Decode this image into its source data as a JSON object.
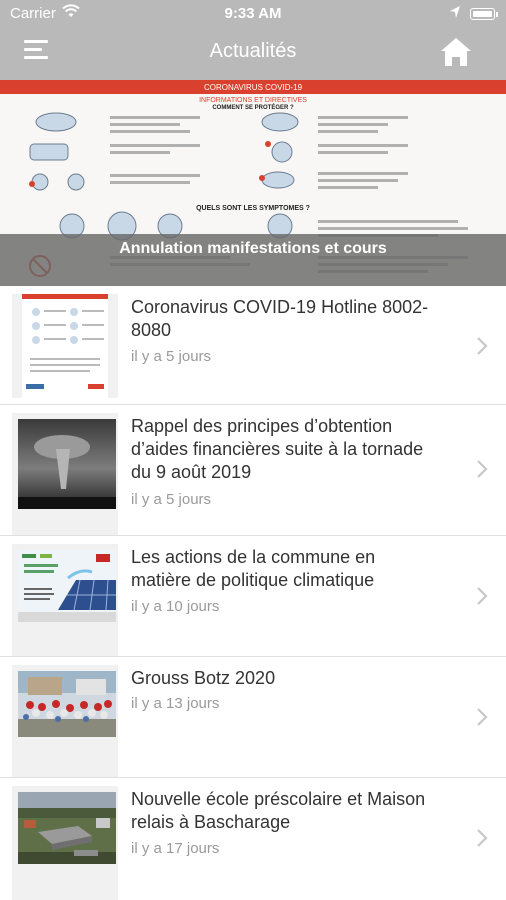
{
  "status_bar": {
    "carrier": "Carrier",
    "time": "9:33 AM"
  },
  "nav": {
    "title": "Actualités",
    "menu_icon": "hamburger-icon",
    "home_icon": "home-icon"
  },
  "hero": {
    "caption": "Annulation manifestations et cours",
    "poster_heading_1": "CORONAVIRUS COVID-19",
    "poster_heading_2": "INFORMATIONS ET DIRECTIVES",
    "poster_section_1": "COMMENT SE PROTÉGER ?",
    "poster_section_2": "QUELS SONT LES SYMPTOMES ?"
  },
  "news": [
    {
      "title": "Coronavirus COVID-19 Hotline 8002-8080",
      "date": "il y a 5 jours"
    },
    {
      "title": "Rappel des principes d’obtention d’aides financières suite à la tornade du 9 août 2019",
      "date": "il y a 5 jours"
    },
    {
      "title": "Les actions de la commune en matière de politique climatique",
      "date": "il y a 10 jours"
    },
    {
      "title": "Grouss Botz 2020",
      "date": "il y a 13 jours"
    },
    {
      "title": "Nouvelle école préscolaire et Maison relais à Bascharage",
      "date": "il y a 17 jours"
    }
  ],
  "colors": {
    "nav_bg": "#b9b9b9",
    "accent_red": "#d9412e",
    "text": "#333333",
    "meta": "#9a9a9a"
  }
}
